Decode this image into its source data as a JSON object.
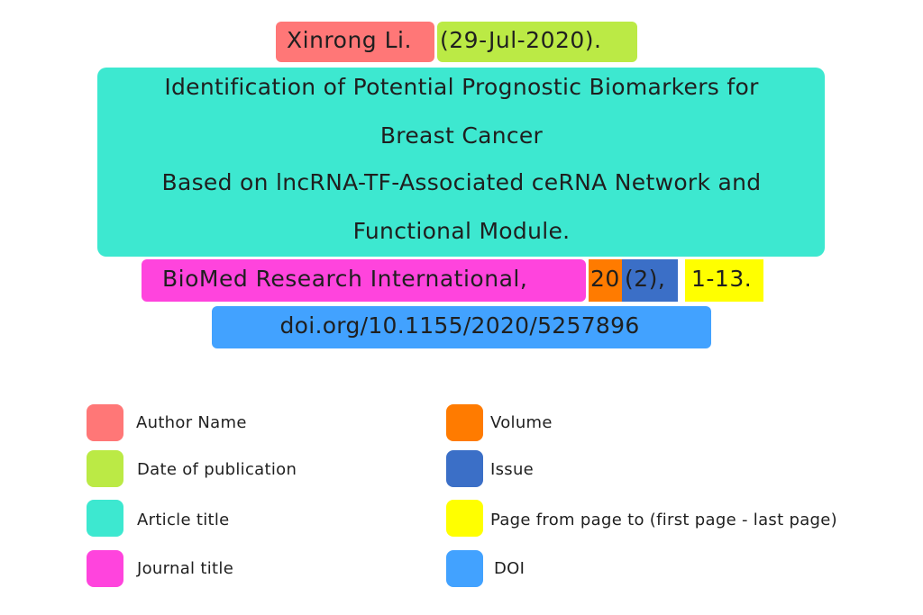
{
  "citation": {
    "author": "Xinrong Li.",
    "date": "(29-Jul-2020).",
    "article_title_lines": [
      "Identification of Potential Prognostic Biomarkers for",
      "Breast Cancer",
      "Based on lncRNA-TF-Associated ceRNA Network and",
      "Functional Module."
    ],
    "journal": "BioMed Research International,",
    "volume": "20",
    "issue": "(2),",
    "pages": "1-13.",
    "doi": "doi.org/10.1155/2020/5257896"
  },
  "legend": [
    {
      "label": "Author Name",
      "color": "#ff7777"
    },
    {
      "label": "Date of publication",
      "color": "#bbea45"
    },
    {
      "label": "Article title",
      "color": "#3de8d0"
    },
    {
      "label": "Journal title",
      "color": "#ff44dd"
    },
    {
      "label": "Volume",
      "color": "#ff7b00"
    },
    {
      "label": "Issue",
      "color": "#3b6fc7"
    },
    {
      "label": "Page from page to (first page - last page)",
      "color": "#ffff00"
    },
    {
      "label": "DOI",
      "color": "#42a2ff"
    }
  ]
}
